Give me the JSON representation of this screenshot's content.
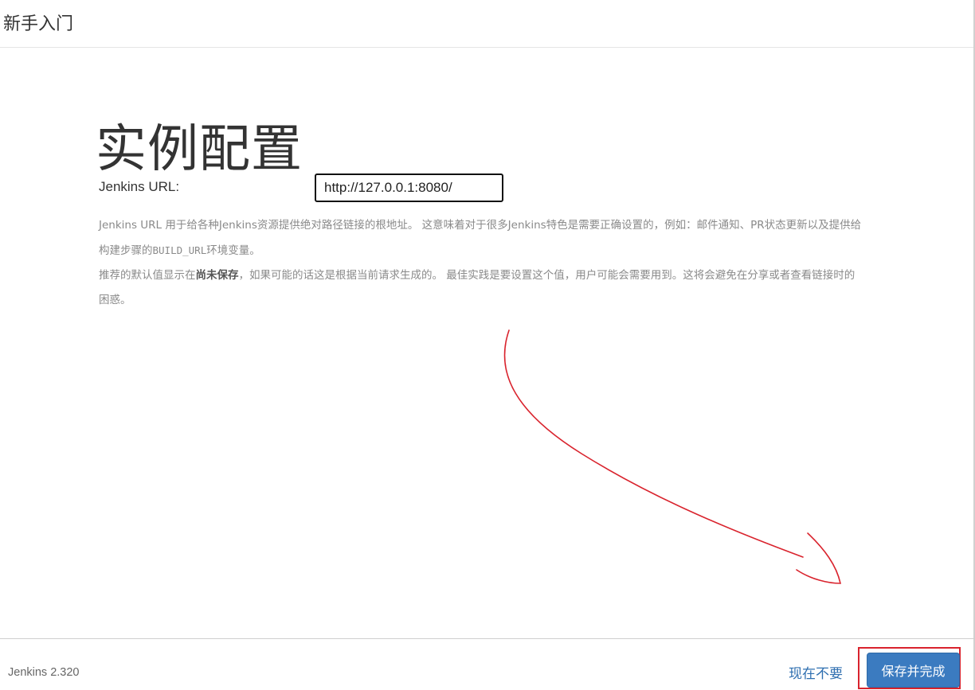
{
  "header": {
    "title": "新手入门"
  },
  "main": {
    "title": "实例配置",
    "url_label": "Jenkins URL:",
    "url_value": "http://127.0.0.1:8080/",
    "help": {
      "p1_a": "Jenkins URL 用于给各种Jenkins资源提供绝对路径链接的根地址。 这意味着对于很多Jenkins特色是需要正确设置的，例如：邮件通知、PR状态更新以及提供给构建步骤的",
      "p1_code": "BUILD_URL",
      "p1_b": "环境变量。",
      "p2_a": "推荐的默认值显示在",
      "p2_bold": "尚未保存",
      "p2_b": "，如果可能的话这是根据当前请求生成的。 最佳实践是要设置这个值，用户可能会需要用到。这将会避免在分享或者查看链接时的困惑。"
    }
  },
  "footer": {
    "version": "Jenkins 2.320",
    "skip_label": "现在不要",
    "save_label": "保存并完成"
  },
  "colors": {
    "primary_button": "#3b7bc0",
    "link": "#2f6fb0",
    "annotation_red": "#d9232d"
  }
}
